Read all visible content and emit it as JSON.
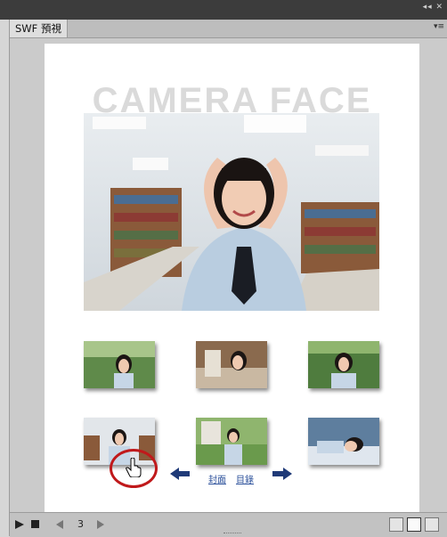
{
  "window": {
    "collapse_glyph": "◂◂ ✕",
    "tab_label": "SWF 預視",
    "menu_glyph": "▾≡"
  },
  "stage": {
    "title": "CAMERA  FACE",
    "hero_image": "photo-girl-in-school-uniform-library",
    "thumbnails": [
      "photo-thumb-1",
      "photo-thumb-2",
      "photo-thumb-3",
      "photo-thumb-4",
      "photo-thumb-5",
      "photo-thumb-6"
    ],
    "links": {
      "cover": "封面",
      "contents": "目錄"
    }
  },
  "controls": {
    "frame_number": "3"
  },
  "colors": {
    "accent_arrow": "#1f3a78",
    "highlight": "#c0191b",
    "link": "#2a4f9a"
  }
}
